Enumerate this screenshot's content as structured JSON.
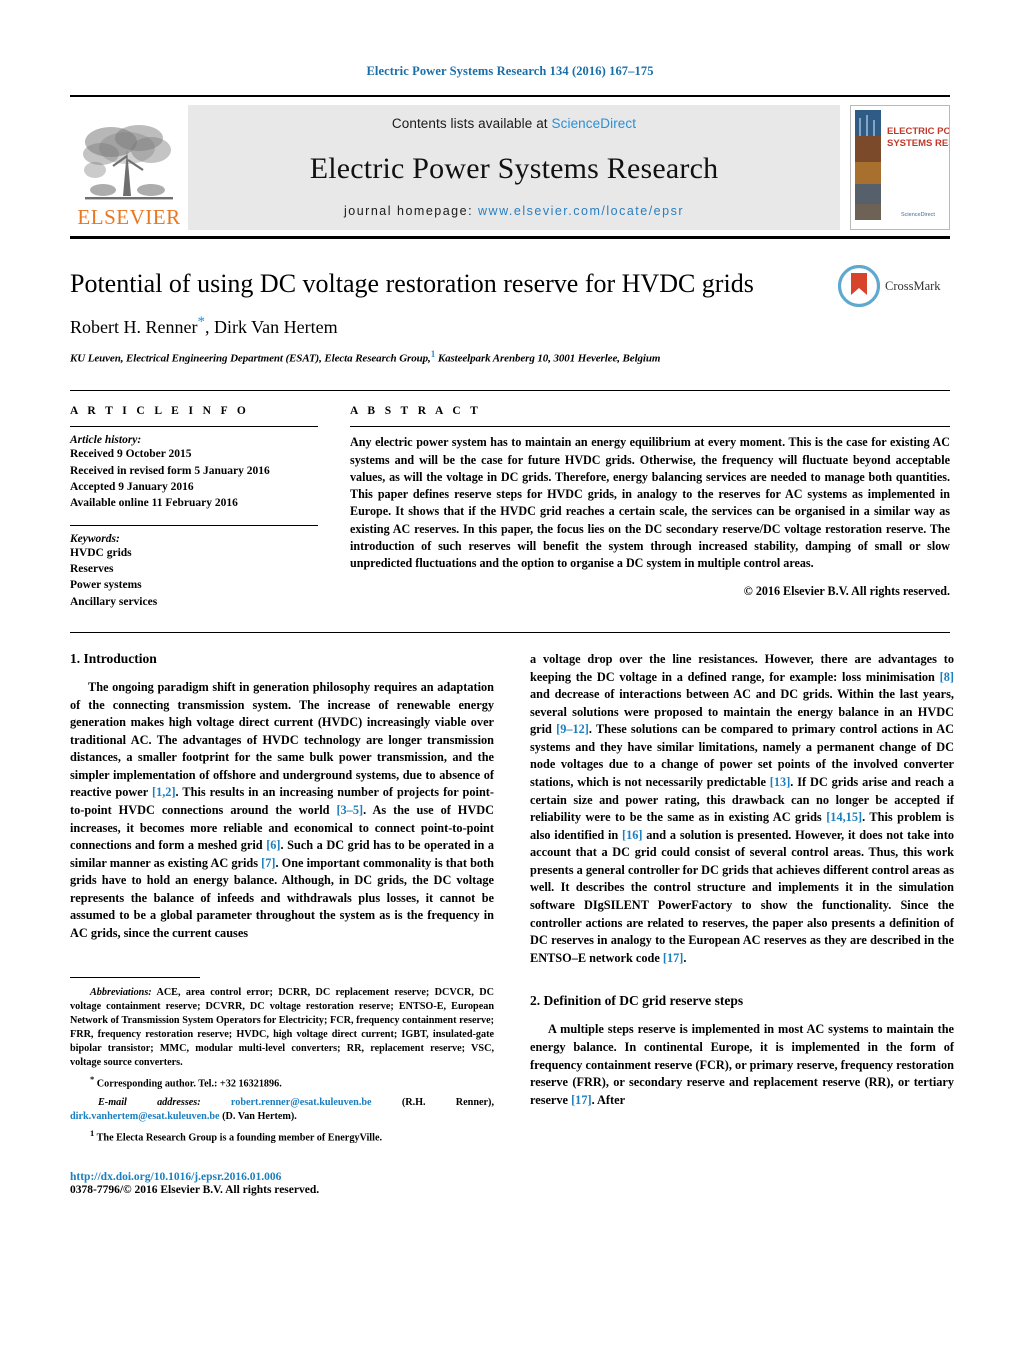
{
  "running_head": "Electric Power Systems Research 134 (2016) 167–175",
  "masthead": {
    "publisher_name": "ELSEVIER",
    "contents_prefix": "Contents lists available at ",
    "contents_link": "ScienceDirect",
    "journal_title": "Electric Power Systems Research",
    "homepage_prefix": "journal homepage: ",
    "homepage_url": "www.elsevier.com/locate/epsr",
    "cover": {
      "line1": "ELECTRIC POWER",
      "line2": "SYSTEMS RESEARCH",
      "footer_brand": "ScienceDirect"
    }
  },
  "title_block": {
    "title": "Potential of using DC voltage restoration reserve for HVDC grids",
    "authors_part1": "Robert H. Renner",
    "authors_star": "*",
    "authors_part2": ", Dirk Van Hertem",
    "affiliation_pre": "KU Leuven, Electrical Engineering Department (ESAT), Electa Research Group,",
    "affiliation_sup": "1",
    "affiliation_post": "Kasteelpark Arenberg 10, 3001 Heverlee, Belgium",
    "crossmark_label": "CrossMark"
  },
  "article_info": {
    "heading": "A R T I C L E    I N F O",
    "history_label": "Article history:",
    "history": [
      "Received 9 October 2015",
      "Received in revised form 5 January 2016",
      "Accepted 9 January 2016",
      "Available online 11 February 2016"
    ],
    "keywords_label": "Keywords:",
    "keywords": [
      "HVDC grids",
      "Reserves",
      "Power systems",
      "Ancillary services"
    ]
  },
  "abstract": {
    "heading": "A B S T R A C T",
    "text": "Any electric power system has to maintain an energy equilibrium at every moment. This is the case for existing AC systems and will be the case for future HVDC grids. Otherwise, the frequency will fluctuate beyond acceptable values, as will the voltage in DC grids. Therefore, energy balancing services are needed to manage both quantities. This paper defines reserve steps for HVDC grids, in analogy to the reserves for AC systems as implemented in Europe. It shows that if the HVDC grid reaches a certain scale, the services can be organised in a similar way as existing AC reserves. In this paper, the focus lies on the DC secondary reserve/DC voltage restoration reserve. The introduction of such reserves will benefit the system through increased stability, damping of small or slow unpredicted fluctuations and the option to organise a DC system in multiple control areas.",
    "copyright": "© 2016 Elsevier B.V. All rights reserved."
  },
  "sections": {
    "intro_heading": "1.  Introduction",
    "intro_p1_a": "The ongoing paradigm shift in generation philosophy requires an adaptation of the connecting transmission system. The increase of renewable energy generation makes high voltage direct current (HVDC) increasingly viable over traditional AC. The advantages of HVDC technology are longer transmission distances, a smaller footprint for the same bulk power transmission, and the simpler implementation of offshore and underground systems, due to absence of reactive power ",
    "intro_ref_1_2": "[1,2]",
    "intro_p1_b": ". This results in an increasing number of projects for point-to-point HVDC connections around the world ",
    "intro_ref_3_5": "[3–5]",
    "intro_p1_c": ". As the use of HVDC increases, it becomes more reliable and economical to connect point-to-point connections and form a meshed grid ",
    "intro_ref_6": "[6]",
    "intro_p1_d": ". Such a DC grid has to be operated in a similar manner as existing AC grids ",
    "intro_ref_7": "[7]",
    "intro_p1_e": ". One important commonality is that both grids have to hold an energy balance. Although, in DC grids, the DC voltage represents the balance of infeeds and withdrawals plus losses, it cannot be assumed to be a global parameter throughout the system as is the frequency in AC grids, since the current causes",
    "intro_p1_cont_a": "a voltage drop over the line resistances. However, there are advantages to keeping the DC voltage in a defined range, for example: loss minimisation ",
    "intro_ref_8": "[8]",
    "intro_p1_cont_b": " and decrease of interactions between AC and DC grids. Within the last years, several solutions were proposed to maintain the energy balance in an HVDC grid ",
    "intro_ref_9_12": "[9–12]",
    "intro_p1_cont_c": ". These solutions can be compared to primary control actions in AC systems and they have similar limitations, namely a permanent change of DC node voltages due to a change of power set points of the involved converter stations, which is not necessarily predictable ",
    "intro_ref_13": "[13]",
    "intro_p1_cont_d": ". If DC grids arise and reach a certain size and power rating, this drawback can no longer be accepted if reliability were to be the same as in existing AC grids ",
    "intro_ref_14_15": "[14,15]",
    "intro_p1_cont_e": ". This problem is also identified in ",
    "intro_ref_16": "[16]",
    "intro_p1_cont_f": " and a solution is presented. However, it does not take into account that a DC grid could consist of several control areas. Thus, this work presents a general controller for DC grids that achieves different control areas as well. It describes the control structure and implements it in the simulation software DIgSILENT PowerFactory to show the functionality. Since the controller actions are related to reserves, the paper also presents a definition of DC reserves in analogy to the European AC reserves as they are described in the ENTSO–E network code ",
    "intro_ref_17": "[17]",
    "intro_p1_cont_g": ".",
    "sec2_heading": "2.  Definition of DC grid reserve steps",
    "sec2_p1_a": "A multiple steps reserve is implemented in most AC systems to maintain the energy balance. In continental Europe, it is implemented in the form of frequency containment reserve (FCR), or primary reserve, frequency restoration reserve (FRR), or secondary reserve and replacement reserve (RR), or tertiary reserve ",
    "sec2_ref_17": "[17]",
    "sec2_p1_b": ". After"
  },
  "footnotes": {
    "abbrev_label": "Abbreviations:",
    "abbrev_text": "  ACE, area control error; DCRR, DC replacement reserve; DCVCR, DC voltage containment reserve; DCVRR, DC voltage restoration reserve; ENTSO-E, European Network of Transmission System Operators for Electricity; FCR, frequency containment reserve; FRR, frequency restoration reserve; HVDC, high voltage direct current; IGBT, insulated-gate bipolar transistor; MMC, modular multi-level converters; RR, replacement reserve; VSC, voltage source converters.",
    "corresponding_marker": "*",
    "corresponding_text": " Corresponding author. Tel.: +32 16321896.",
    "email_label": "E-mail addresses:",
    "email1": "robert.renner@esat.kuleuven.be",
    "email1_owner": " (R.H. Renner),",
    "email2": "dirk.vanhertem@esat.kuleuven.be",
    "email2_owner": " (D. Van Hertem).",
    "footnote1_marker": "1",
    "footnote1_text": " The Electa Research Group is a founding member of EnergyVille.",
    "doi": "http://dx.doi.org/10.1016/j.epsr.2016.01.006",
    "issn_line": "0378-7796/© 2016 Elsevier B.V. All rights reserved."
  },
  "colors": {
    "link_blue": "#1a7fbf",
    "sciencedirect_blue": "#2a8fd4",
    "elsevier_orange": "#E87722",
    "banner_gray": "#e8e8e8",
    "crossmark_red": "#d6452b",
    "crossmark_blue": "#5fa8cf"
  }
}
